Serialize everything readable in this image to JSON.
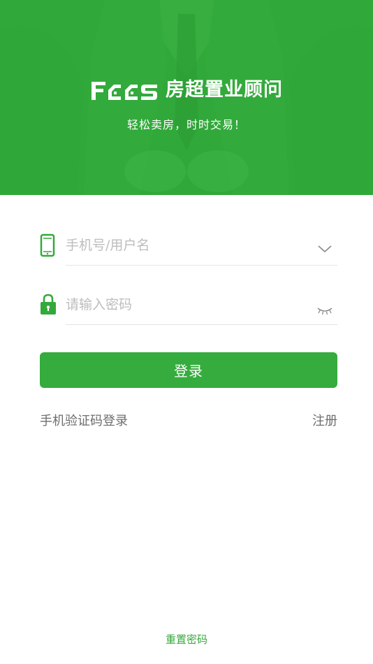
{
  "banner": {
    "logo_text": "房超置业顾问",
    "slogan": "轻松卖房，时时交易！"
  },
  "form": {
    "username": {
      "placeholder": "手机号/用户名",
      "value": "",
      "icon": "phone-icon",
      "action_icon": "chevron-down-icon"
    },
    "password": {
      "placeholder": "请输入密码",
      "value": "",
      "icon": "lock-icon",
      "action_icon": "eye-closed-icon"
    },
    "login_label": "登录"
  },
  "links": {
    "sms_login": "手机验证码登录",
    "register": "注册",
    "reset_password": "重置密码"
  },
  "colors": {
    "brand_green": "#31a83a",
    "button_green": "#35ac3d",
    "link_gray": "#6d6d6d",
    "placeholder_gray": "#bdbdbd"
  }
}
